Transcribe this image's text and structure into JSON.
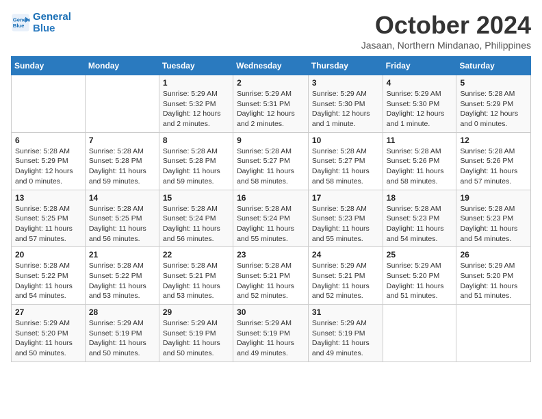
{
  "header": {
    "logo_line1": "General",
    "logo_line2": "Blue",
    "month": "October 2024",
    "location": "Jasaan, Northern Mindanao, Philippines"
  },
  "days_of_week": [
    "Sunday",
    "Monday",
    "Tuesday",
    "Wednesday",
    "Thursday",
    "Friday",
    "Saturday"
  ],
  "weeks": [
    [
      {
        "day": "",
        "detail": ""
      },
      {
        "day": "",
        "detail": ""
      },
      {
        "day": "1",
        "detail": "Sunrise: 5:29 AM\nSunset: 5:32 PM\nDaylight: 12 hours and 2 minutes."
      },
      {
        "day": "2",
        "detail": "Sunrise: 5:29 AM\nSunset: 5:31 PM\nDaylight: 12 hours and 2 minutes."
      },
      {
        "day": "3",
        "detail": "Sunrise: 5:29 AM\nSunset: 5:30 PM\nDaylight: 12 hours and 1 minute."
      },
      {
        "day": "4",
        "detail": "Sunrise: 5:29 AM\nSunset: 5:30 PM\nDaylight: 12 hours and 1 minute."
      },
      {
        "day": "5",
        "detail": "Sunrise: 5:28 AM\nSunset: 5:29 PM\nDaylight: 12 hours and 0 minutes."
      }
    ],
    [
      {
        "day": "6",
        "detail": "Sunrise: 5:28 AM\nSunset: 5:29 PM\nDaylight: 12 hours and 0 minutes."
      },
      {
        "day": "7",
        "detail": "Sunrise: 5:28 AM\nSunset: 5:28 PM\nDaylight: 11 hours and 59 minutes."
      },
      {
        "day": "8",
        "detail": "Sunrise: 5:28 AM\nSunset: 5:28 PM\nDaylight: 11 hours and 59 minutes."
      },
      {
        "day": "9",
        "detail": "Sunrise: 5:28 AM\nSunset: 5:27 PM\nDaylight: 11 hours and 58 minutes."
      },
      {
        "day": "10",
        "detail": "Sunrise: 5:28 AM\nSunset: 5:27 PM\nDaylight: 11 hours and 58 minutes."
      },
      {
        "day": "11",
        "detail": "Sunrise: 5:28 AM\nSunset: 5:26 PM\nDaylight: 11 hours and 58 minutes."
      },
      {
        "day": "12",
        "detail": "Sunrise: 5:28 AM\nSunset: 5:26 PM\nDaylight: 11 hours and 57 minutes."
      }
    ],
    [
      {
        "day": "13",
        "detail": "Sunrise: 5:28 AM\nSunset: 5:25 PM\nDaylight: 11 hours and 57 minutes."
      },
      {
        "day": "14",
        "detail": "Sunrise: 5:28 AM\nSunset: 5:25 PM\nDaylight: 11 hours and 56 minutes."
      },
      {
        "day": "15",
        "detail": "Sunrise: 5:28 AM\nSunset: 5:24 PM\nDaylight: 11 hours and 56 minutes."
      },
      {
        "day": "16",
        "detail": "Sunrise: 5:28 AM\nSunset: 5:24 PM\nDaylight: 11 hours and 55 minutes."
      },
      {
        "day": "17",
        "detail": "Sunrise: 5:28 AM\nSunset: 5:23 PM\nDaylight: 11 hours and 55 minutes."
      },
      {
        "day": "18",
        "detail": "Sunrise: 5:28 AM\nSunset: 5:23 PM\nDaylight: 11 hours and 54 minutes."
      },
      {
        "day": "19",
        "detail": "Sunrise: 5:28 AM\nSunset: 5:23 PM\nDaylight: 11 hours and 54 minutes."
      }
    ],
    [
      {
        "day": "20",
        "detail": "Sunrise: 5:28 AM\nSunset: 5:22 PM\nDaylight: 11 hours and 54 minutes."
      },
      {
        "day": "21",
        "detail": "Sunrise: 5:28 AM\nSunset: 5:22 PM\nDaylight: 11 hours and 53 minutes."
      },
      {
        "day": "22",
        "detail": "Sunrise: 5:28 AM\nSunset: 5:21 PM\nDaylight: 11 hours and 53 minutes."
      },
      {
        "day": "23",
        "detail": "Sunrise: 5:28 AM\nSunset: 5:21 PM\nDaylight: 11 hours and 52 minutes."
      },
      {
        "day": "24",
        "detail": "Sunrise: 5:29 AM\nSunset: 5:21 PM\nDaylight: 11 hours and 52 minutes."
      },
      {
        "day": "25",
        "detail": "Sunrise: 5:29 AM\nSunset: 5:20 PM\nDaylight: 11 hours and 51 minutes."
      },
      {
        "day": "26",
        "detail": "Sunrise: 5:29 AM\nSunset: 5:20 PM\nDaylight: 11 hours and 51 minutes."
      }
    ],
    [
      {
        "day": "27",
        "detail": "Sunrise: 5:29 AM\nSunset: 5:20 PM\nDaylight: 11 hours and 50 minutes."
      },
      {
        "day": "28",
        "detail": "Sunrise: 5:29 AM\nSunset: 5:19 PM\nDaylight: 11 hours and 50 minutes."
      },
      {
        "day": "29",
        "detail": "Sunrise: 5:29 AM\nSunset: 5:19 PM\nDaylight: 11 hours and 50 minutes."
      },
      {
        "day": "30",
        "detail": "Sunrise: 5:29 AM\nSunset: 5:19 PM\nDaylight: 11 hours and 49 minutes."
      },
      {
        "day": "31",
        "detail": "Sunrise: 5:29 AM\nSunset: 5:19 PM\nDaylight: 11 hours and 49 minutes."
      },
      {
        "day": "",
        "detail": ""
      },
      {
        "day": "",
        "detail": ""
      }
    ]
  ]
}
